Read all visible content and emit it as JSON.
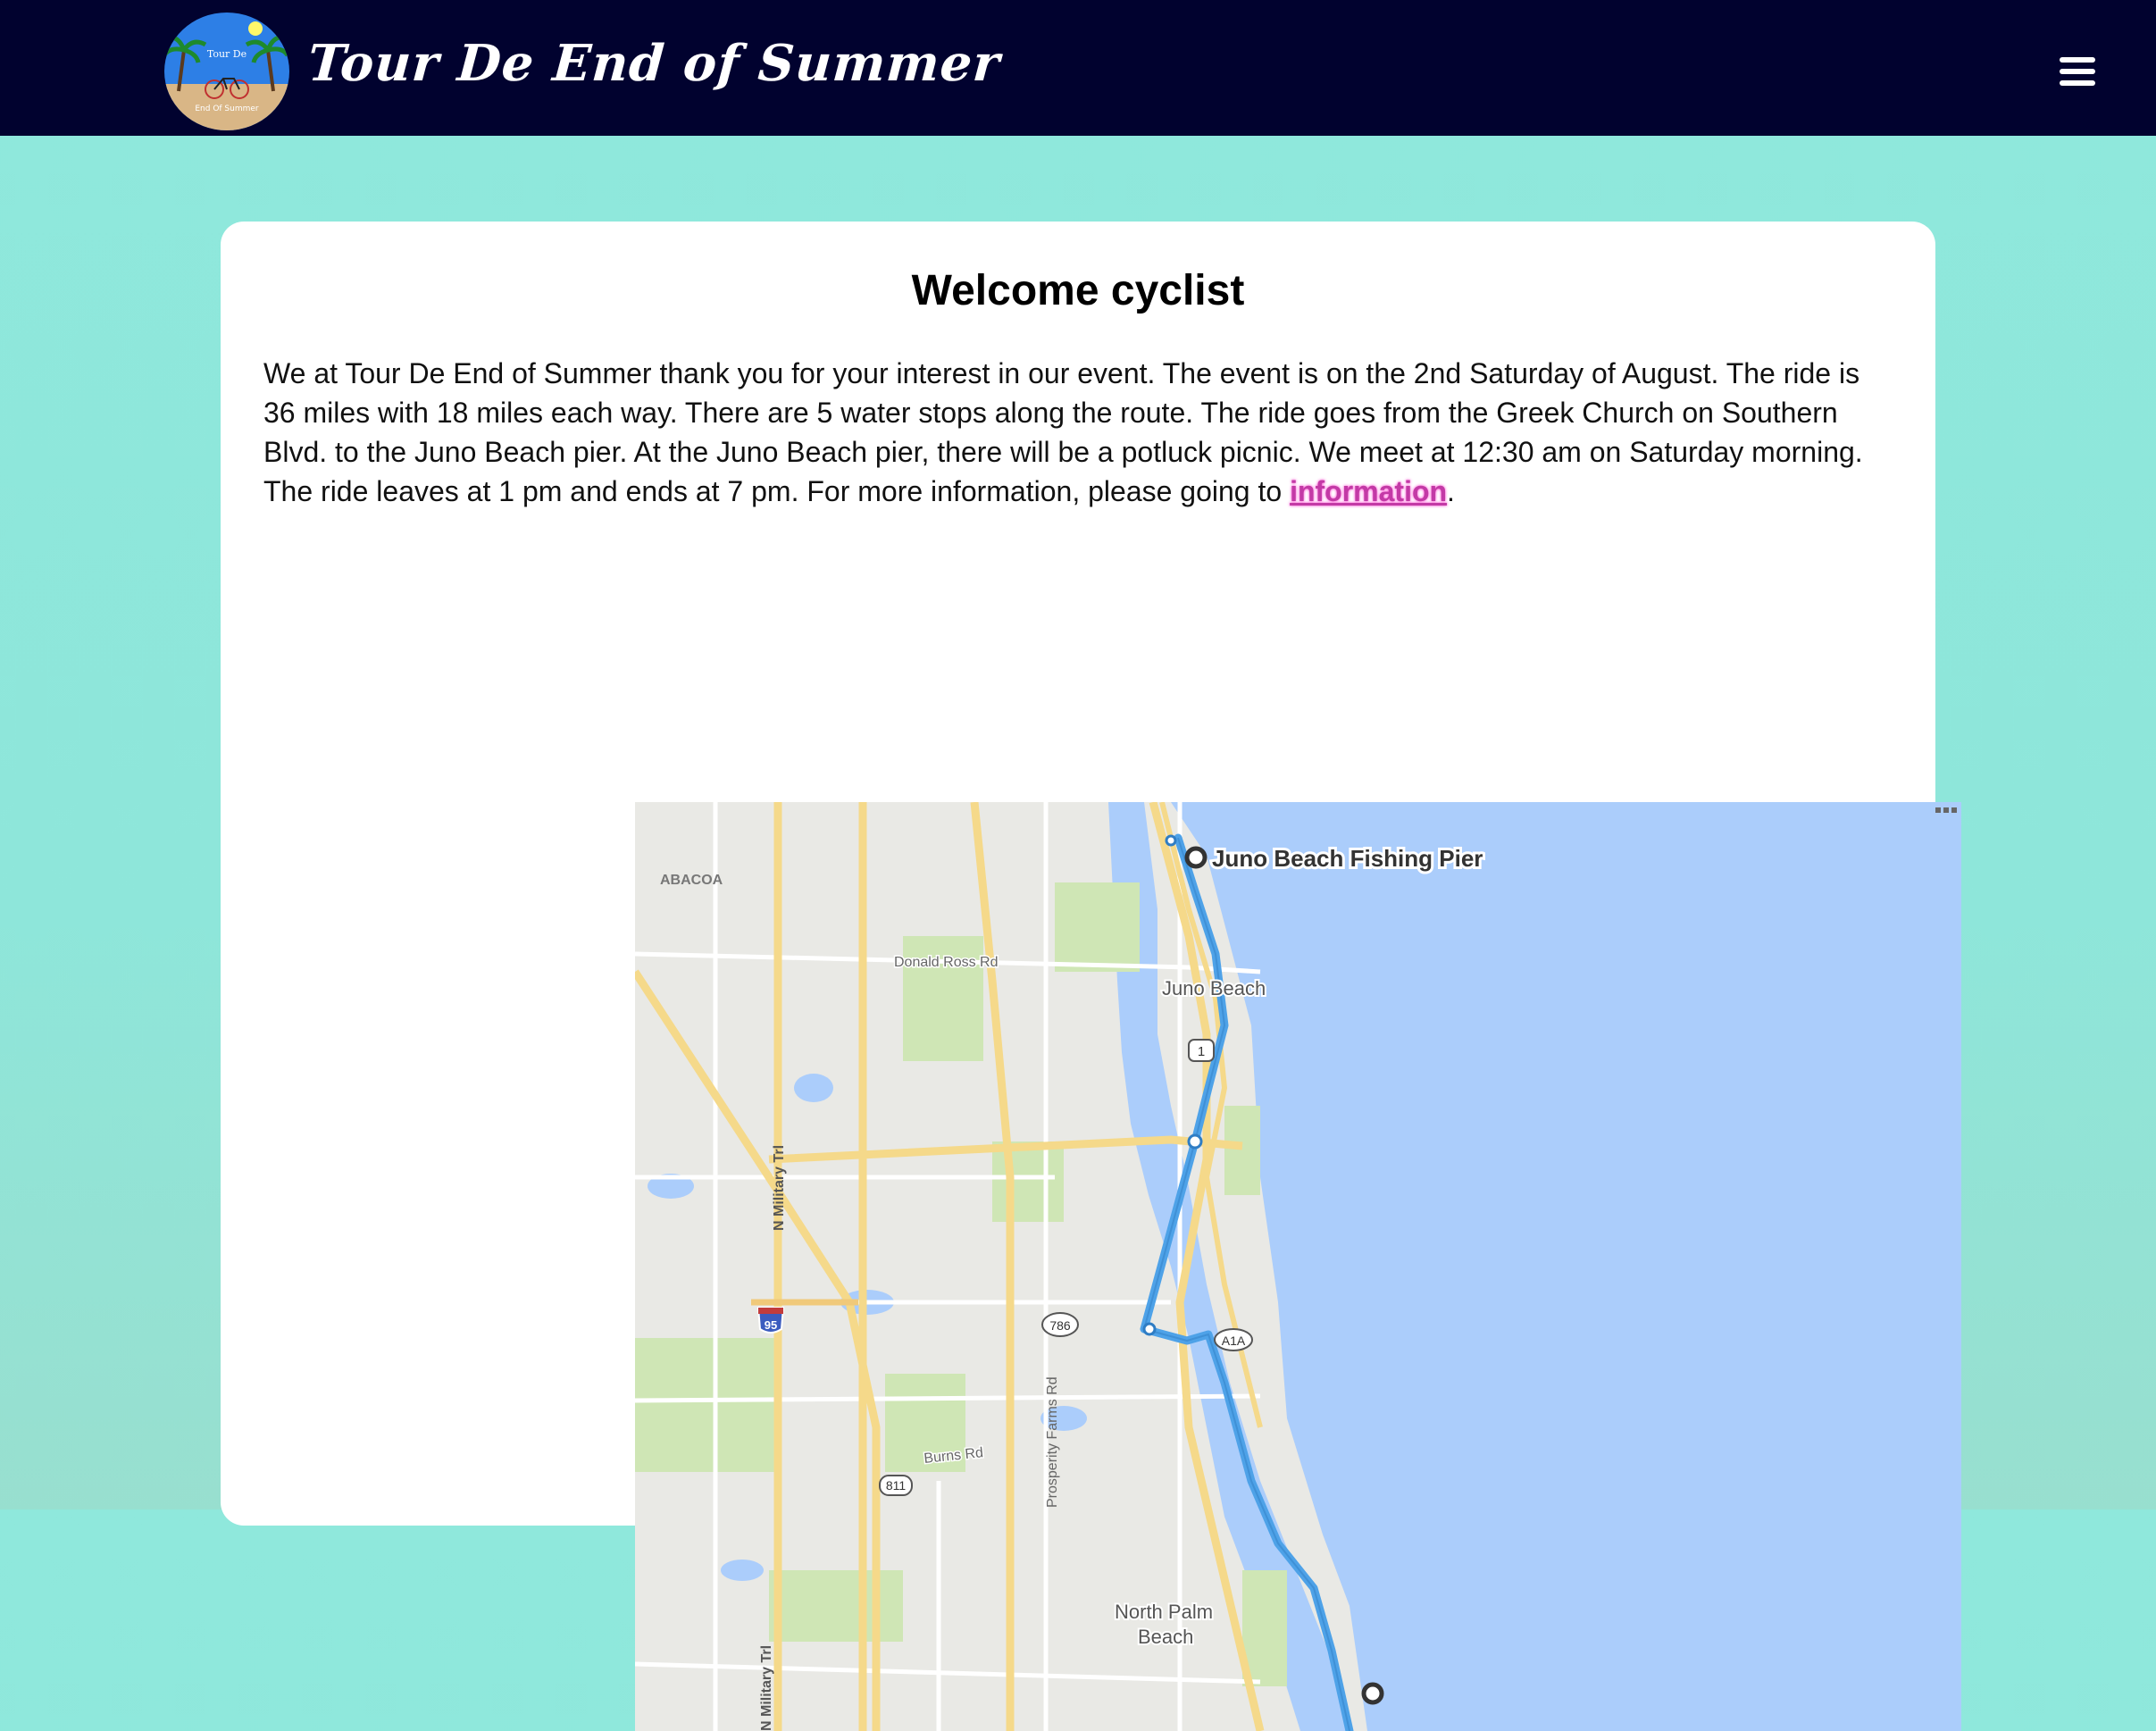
{
  "header": {
    "brand_title": "Tour De End of Summer",
    "logo_text_top": "Tour De",
    "logo_text_bottom": "End Of Summer",
    "menu_icon": "hamburger-menu-icon"
  },
  "main": {
    "heading": "Welcome cyclist",
    "intro_text": "We at Tour De End of Summer thank you for your interest in our event. The event is on the 2nd Saturday of August. The ride is 36 miles with 18 miles each way. There are 5 water stops along the route. The ride goes from the Greek Church on Southern Blvd. to the Juno Beach pier. At the Juno Beach pier, there will be a potluck picnic. We meet at 12:30 am on Saturday morning. The ride leaves at 1 pm and ends at 7 pm. For more information, please going to ",
    "info_link": "information",
    "intro_end": "."
  },
  "map": {
    "destination_label": "Juno Beach Fishing Pier",
    "places": {
      "abacoa": "ABACOA",
      "juno_beach": "Juno Beach",
      "north_palm_beach_1": "North Palm",
      "north_palm_beach_2": "Beach"
    },
    "roads": {
      "donald_ross": "Donald Ross Rd",
      "n_military_1": "N Military Trl",
      "n_military_2": "N Military Trl",
      "prosperity_farms": "Prosperity Farms Rd",
      "burns": "Burns Rd"
    },
    "shields": {
      "us1": "1",
      "i95": "95",
      "sr786": "786",
      "a1a": "A1A",
      "cr811": "811"
    }
  },
  "colors": {
    "topbar": "#01022f",
    "page_bg": "#8fe8dc",
    "link": "#c33aa6",
    "ocean": "#abcdfb",
    "route": "#4ea2e8"
  }
}
